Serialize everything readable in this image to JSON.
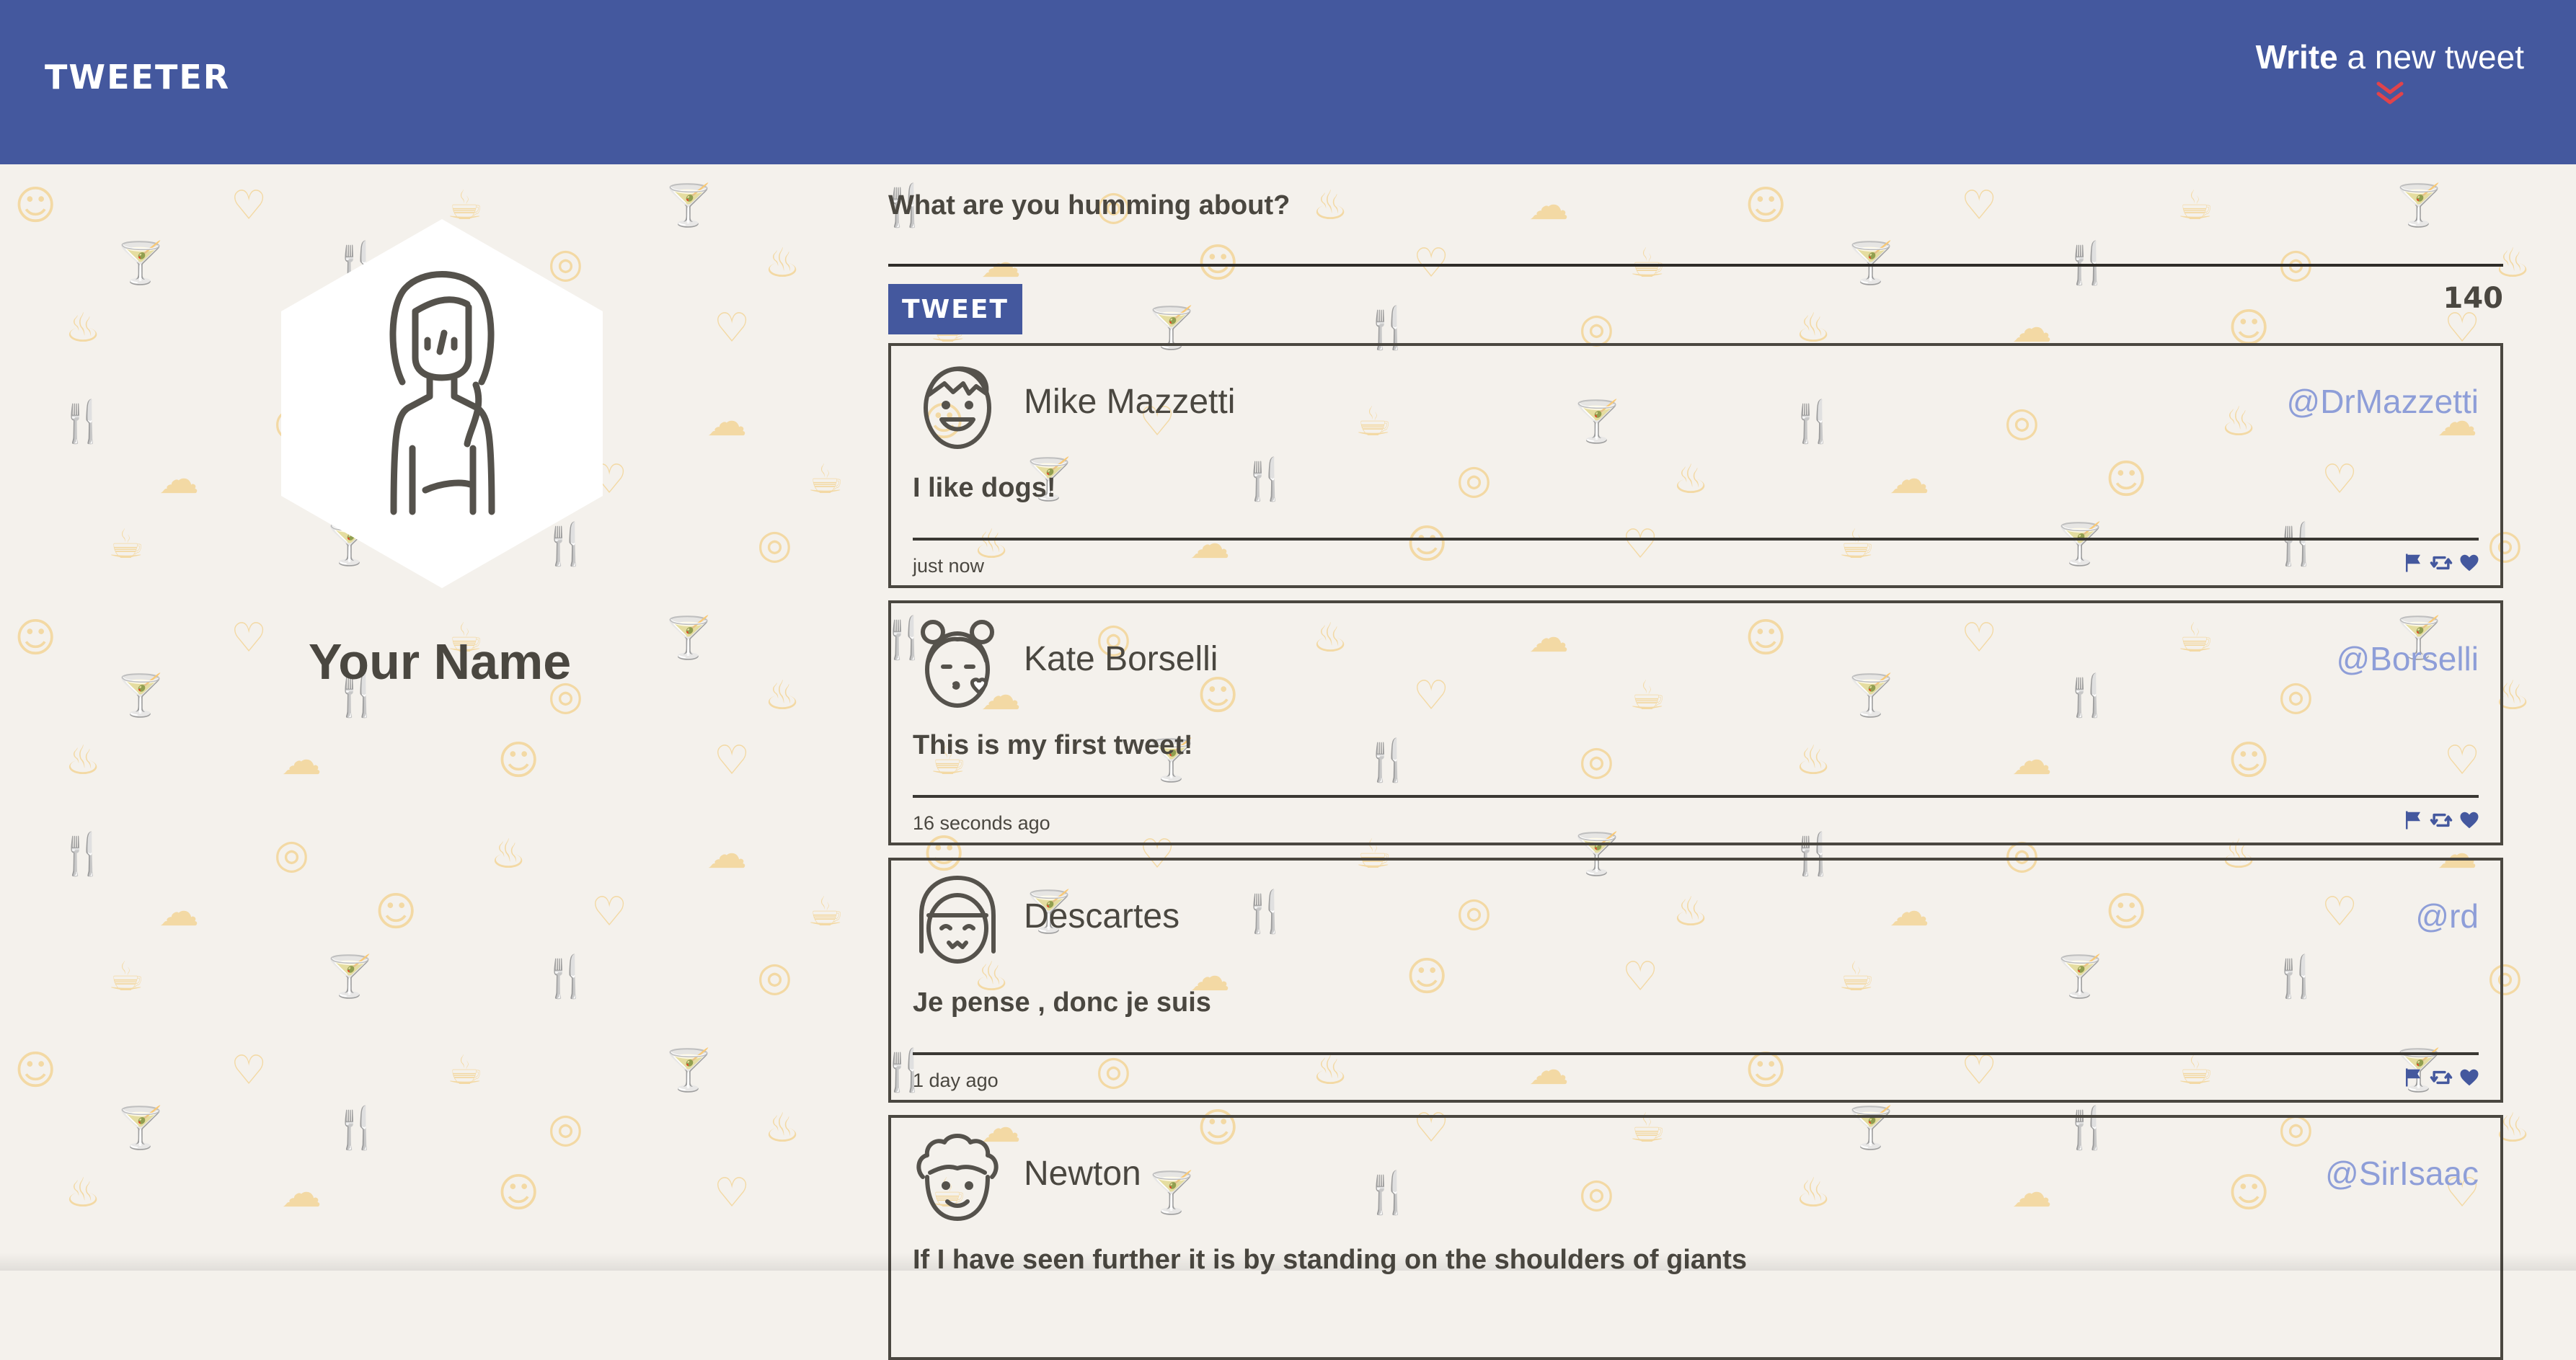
{
  "nav": {
    "brand": "TWEETER",
    "compose_toggle_strong": "Write",
    "compose_toggle_rest": " a new tweet"
  },
  "profile": {
    "name": "Your Name"
  },
  "compose": {
    "label": "What are you humming about?",
    "button_label": "TWEET",
    "char_counter": "140"
  },
  "tweets": [
    {
      "name": "Mike Mazzetti",
      "handle": "@DrMazzetti",
      "text": "I like dogs!",
      "time": "just now",
      "avatar_icon": "smiling-man-avatar-icon"
    },
    {
      "name": "Kate Borselli",
      "handle": "@Borselli",
      "text": "This is my first tweet!",
      "time": "16 seconds ago",
      "avatar_icon": "kissing-woman-avatar-icon"
    },
    {
      "name": "Descartes",
      "handle": "@rd",
      "text": "Je pense , donc je suis",
      "time": "1 day ago",
      "avatar_icon": "bob-hair-avatar-icon"
    },
    {
      "name": "Newton",
      "handle": "@SirIsaac",
      "text": "If I have seen further it is by standing on the shoulders of giants",
      "time": "",
      "avatar_icon": "curly-hair-avatar-icon"
    }
  ],
  "action_icons": [
    "flag-icon",
    "retweet-icon",
    "heart-icon"
  ],
  "colors": {
    "nav_bg": "#44589e",
    "accent": "#44589e",
    "chevron": "#e0434b",
    "handle": "#8e9ed8",
    "page_bg": "#f4f1ec",
    "pattern": "#f3d9a4",
    "text": "#4a4740"
  }
}
